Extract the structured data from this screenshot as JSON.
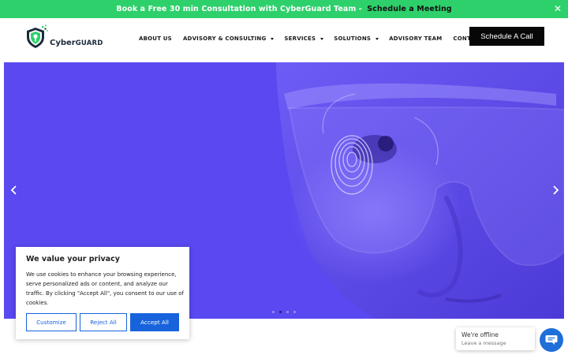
{
  "banner": {
    "text": "Book a Free 30 min Consultation with CyberGuard Team - ",
    "link": "Schedule a Meeting",
    "close_icon": "close-icon",
    "color": "#2ed06b"
  },
  "header": {
    "logo": {
      "word1": "Cyber",
      "word2": "GUARD",
      "icon": "shield-icon"
    },
    "nav": [
      {
        "label": "ABOUT US",
        "has_dropdown": false
      },
      {
        "label": "ADVISORY & CONSULTING",
        "has_dropdown": true
      },
      {
        "label": "SERVICES",
        "has_dropdown": true
      },
      {
        "label": "SOLUTIONS",
        "has_dropdown": true
      },
      {
        "label": "ADVISORY TEAM",
        "has_dropdown": false
      },
      {
        "label": "CONTACT",
        "has_dropdown": false
      }
    ],
    "cta": "Schedule A Call"
  },
  "hero": {
    "overlay_color": "#5a48f0",
    "prev_icon": "chevron-left-icon",
    "next_icon": "chevron-right-icon",
    "slide_count": 4,
    "active_slide": 2
  },
  "cookie": {
    "title": "We value your privacy",
    "body": "We use cookies to enhance your browsing experience, serve personalized ads or content, and analyze our traffic. By clicking \"Accept All\", you consent to our use of cookies.",
    "customize": "Customize",
    "reject": "Reject All",
    "accept": "Accept All",
    "accent": "#1863dc"
  },
  "chat": {
    "status": "We're offline",
    "sub": "Leave a message",
    "icon": "chat-icon",
    "color": "#1e6fd9"
  }
}
